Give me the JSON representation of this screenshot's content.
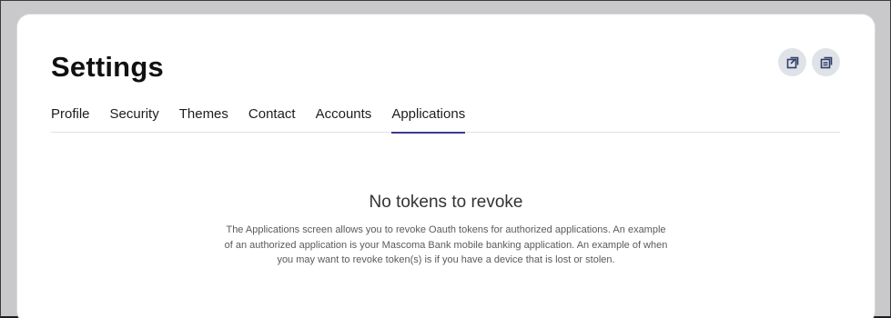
{
  "page": {
    "title": "Settings"
  },
  "header_actions": [
    {
      "icon": "export-icon"
    },
    {
      "icon": "document-icon"
    }
  ],
  "tabs": [
    {
      "label": "Profile",
      "active": false
    },
    {
      "label": "Security",
      "active": false
    },
    {
      "label": "Themes",
      "active": false
    },
    {
      "label": "Contact",
      "active": false
    },
    {
      "label": "Accounts",
      "active": false
    },
    {
      "label": "Applications",
      "active": true
    }
  ],
  "empty_state": {
    "title": "No tokens to revoke",
    "description": "The Applications screen allows you to revoke Oauth tokens for authorized applications. An example of an authorized application is your Mascoma Bank mobile banking application. An example of when you may want to revoke token(s) is if you have a device that is lost or stolen."
  },
  "colors": {
    "accent": "#3d3a8c",
    "icon_bg": "#dfe3e8",
    "icon_fg": "#2e3e66",
    "outer_bg": "#c9c9cc"
  }
}
